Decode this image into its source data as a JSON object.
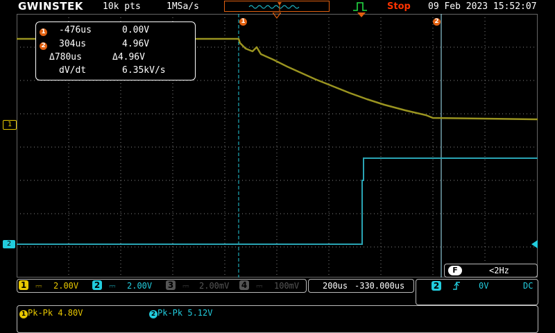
{
  "header": {
    "brand": "GWINSTEK",
    "record_length": "10k pts",
    "sample_rate": "1MSa/s",
    "run_status": "Stop",
    "datetime": "09 Feb 2023 15:52:07"
  },
  "cursors": {
    "c1_label": "1",
    "c2_label": "2",
    "rows": [
      {
        "badge": "1",
        "time": "-476us",
        "volt": "0.00V"
      },
      {
        "badge": "2",
        "time": "304us",
        "volt": "4.96V"
      },
      {
        "badge": "",
        "time": "Δ780us",
        "volt": "Δ4.96V"
      }
    ],
    "dvdt_label": "dV/dt",
    "dvdt_value": "6.35kV/s"
  },
  "markers": {
    "ch1": "1",
    "ch2": "2"
  },
  "channels": [
    {
      "num": "1",
      "coupling": "⎓",
      "scale": "2.00V",
      "color": "#e8c800"
    },
    {
      "num": "2",
      "coupling": "⎓",
      "scale": "2.00V",
      "color": "#22ccdd"
    },
    {
      "num": "3",
      "coupling": "⎓",
      "scale": "2.00mV",
      "color": "#555555"
    },
    {
      "num": "4",
      "coupling": "⎓",
      "scale": "100mV",
      "color": "#555555"
    }
  ],
  "timebase": {
    "scale": "200us",
    "position": "-330.000us"
  },
  "trigger": {
    "source": "2",
    "slope_icon": "rising-edge",
    "level": "0V",
    "coupling": "DC",
    "filter_label": "F",
    "frequency": "<2Hz"
  },
  "measurements": [
    {
      "badge": "1",
      "text": "Pk-Pk 4.80V",
      "color": "#e8c800"
    },
    {
      "badge": "2",
      "text": "Pk-Pk 5.12V",
      "color": "#22ccdd"
    }
  ],
  "colors": {
    "ch1": "#9a9420",
    "ch2": "#2aa5b5",
    "accent": "#e06010",
    "stop": "#ff3300"
  }
}
